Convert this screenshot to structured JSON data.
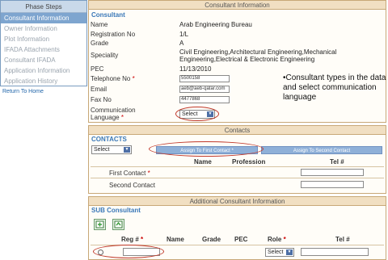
{
  "sidebar": {
    "header": "Phase Steps",
    "items": [
      {
        "label": "Consultant Information"
      },
      {
        "label": "Owner Information"
      },
      {
        "label": "Plot Information"
      },
      {
        "label": "IFADA Attachments"
      },
      {
        "label": "Consultant IFADA"
      },
      {
        "label": "Application Information"
      },
      {
        "label": "Application History"
      }
    ],
    "return_link": "Return To Home"
  },
  "consultant": {
    "header": "Consultant Information",
    "subheader": "Consultant",
    "name_label": "Name",
    "name_value": "Arab Engineering Bureau",
    "registration_label": "Registration No",
    "registration_value": "1/L",
    "grade_label": "Grade",
    "grade_value": "A",
    "speciality_label": "Speciality",
    "speciality_value": "Civil Engineering,Architectural Engineering,Mechanical Engineering,Electrical & Electronic Engineering",
    "pec_label": "PEC",
    "pec_value": "11/13/2010",
    "telephone_label": "Telephone No",
    "telephone_value": "5500158",
    "email_label": "Email",
    "email_value": "aeb@aeb-qatar.com",
    "fax_label": "Fax No",
    "fax_value": "4477868",
    "language_label": "Communication Language",
    "language_select": "Select",
    "required_mark": "*"
  },
  "callout": {
    "text": "•Consultant types in the data and select communication language"
  },
  "contacts": {
    "header": "Contacts",
    "subheader": "CONTACTS",
    "select_value": "Select",
    "assign_first_label": "Assign To First Contact *",
    "assign_second_label": "Assign To Second Contact",
    "columns": [
      "Name",
      "Profession",
      "Tel #"
    ],
    "first_contact_label": "First Contact",
    "second_contact_label": "Second Contact"
  },
  "sub_consultant": {
    "header": "Additional Consultant Information",
    "subheader": "SUB Consultant",
    "columns": {
      "reg": "Reg #",
      "name": "Name",
      "grade": "Grade",
      "pec": "PEC",
      "role": "Role",
      "tel": "Tel #"
    },
    "role_select": "Select"
  },
  "colors": {
    "accent_blue": "#3a78b8",
    "panel_border": "#c8a878",
    "required_red": "#cc0000",
    "highlight_red": "#c0392b"
  }
}
